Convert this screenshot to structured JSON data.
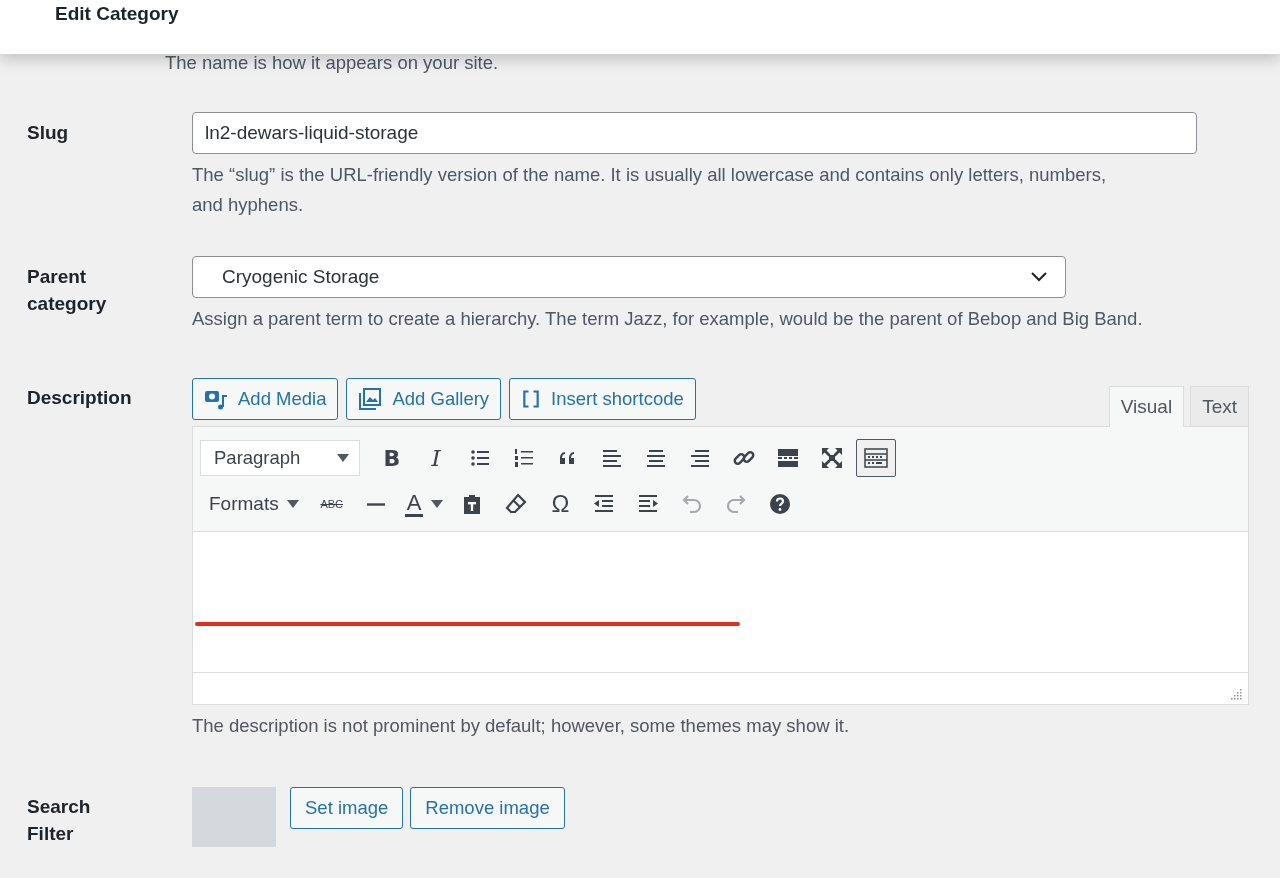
{
  "header": {
    "title": "Edit Category"
  },
  "name_help": "The name is how it appears on your site.",
  "slug": {
    "label": "Slug",
    "value": "ln2-dewars-liquid-storage",
    "help": "The “slug” is the URL-friendly version of the name. It is usually all lowercase and contains only letters, numbers, and hyphens."
  },
  "parent": {
    "label": "Parent\ncategory",
    "value": "Cryogenic Storage",
    "help": "Assign a parent term to create a hierarchy. The term Jazz, for example, would be the parent of Bebop and Big Band."
  },
  "description": {
    "label": "Description",
    "media_buttons": [
      {
        "kind": "media",
        "label": "Add Media"
      },
      {
        "kind": "gallery",
        "label": "Add Gallery"
      },
      {
        "kind": "shortcode",
        "label": "Insert shortcode"
      }
    ],
    "tabs": [
      {
        "label": "Visual",
        "selected": true
      },
      {
        "label": "Text",
        "selected": false
      }
    ],
    "toolbar_rows": [
      [
        {
          "kind": "select",
          "label": "Paragraph"
        },
        {
          "kind": "bold",
          "label": "B"
        },
        {
          "kind": "italic",
          "label": "I"
        },
        {
          "kind": "bullets"
        },
        {
          "kind": "numbers"
        },
        {
          "kind": "quote"
        },
        {
          "kind": "alignleft"
        },
        {
          "kind": "aligncenter"
        },
        {
          "kind": "alignright"
        },
        {
          "kind": "link"
        },
        {
          "kind": "more"
        },
        {
          "kind": "fullscreen"
        },
        {
          "kind": "kitchensink",
          "pressed": true
        }
      ],
      [
        {
          "kind": "formats",
          "label": "Formats"
        },
        {
          "kind": "strike",
          "label": "ABC"
        },
        {
          "kind": "hr"
        },
        {
          "kind": "color",
          "label": "A"
        },
        {
          "kind": "paste"
        },
        {
          "kind": "eraser"
        },
        {
          "kind": "char",
          "label": "Ω"
        },
        {
          "kind": "outdent"
        },
        {
          "kind": "indent"
        },
        {
          "kind": "undo",
          "disabled": true
        },
        {
          "kind": "redo",
          "disabled": true
        },
        {
          "kind": "help"
        }
      ]
    ],
    "help": "The description is not prominent by default; however, some themes may show it."
  },
  "search_filter": {
    "label": "Search\nFilter",
    "buttons": [
      "Set image",
      "Remove image"
    ]
  }
}
